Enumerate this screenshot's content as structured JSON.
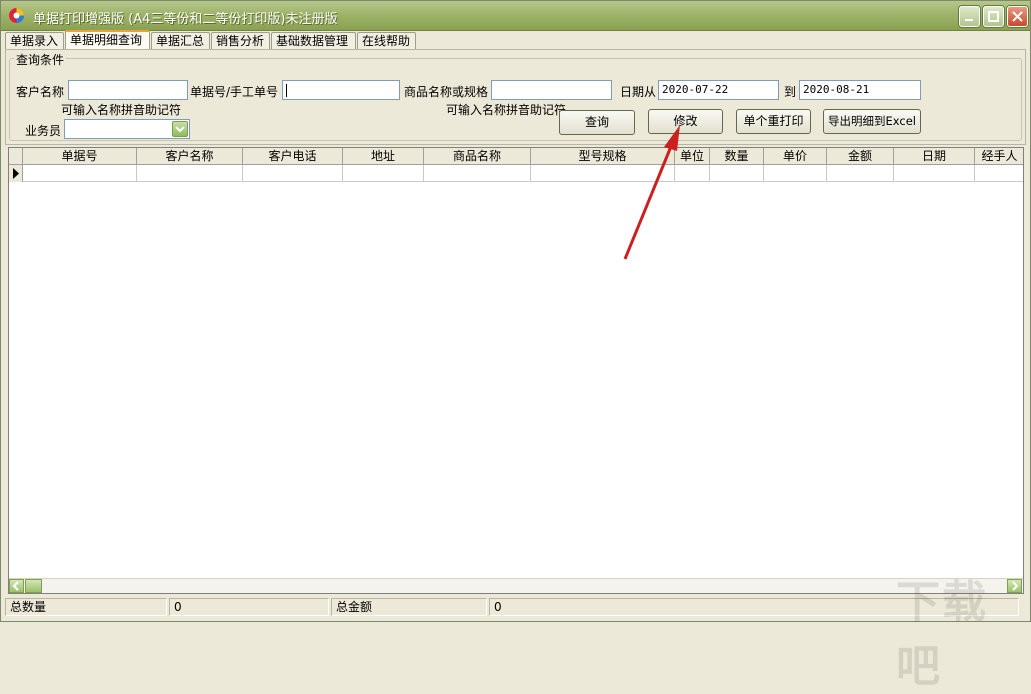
{
  "window": {
    "title": "单据打印增强版 (A4三等份和二等份打印版)未注册版"
  },
  "tabs": [
    {
      "label": "单据录入",
      "active": false
    },
    {
      "label": "单据明细查询",
      "active": true
    },
    {
      "label": "单据汇总",
      "active": false
    },
    {
      "label": "销售分析",
      "active": false
    },
    {
      "label": "基础数据管理",
      "active": false
    },
    {
      "label": "在线帮助",
      "active": false
    }
  ],
  "query": {
    "group_title": "查询条件",
    "customer_label": "客户名称",
    "customer_value": "",
    "customer_hint": "可输入名称拼音助记符",
    "doc_no_label": "单据号/手工单号",
    "doc_no_value": "",
    "product_label": "商品名称或规格",
    "product_value": "",
    "product_hint": "可输入名称拼音助记符",
    "date_from_label": "日期从",
    "date_from_value": "2020-07-22",
    "date_to_label": "到",
    "date_to_value": "2020-08-21",
    "salesperson_label": "业务员",
    "salesperson_value": "",
    "buttons": {
      "search": "查询",
      "modify": "修改",
      "reprint": "单个重打印",
      "export": "导出明细到Excel"
    }
  },
  "grid": {
    "columns": [
      "单据号",
      "客户名称",
      "客户电话",
      "地址",
      "商品名称",
      "型号规格",
      "单位",
      "数量",
      "单价",
      "金额",
      "日期",
      "经手人"
    ]
  },
  "status": {
    "total_qty_label": "总数量",
    "total_qty_value": "0",
    "total_amount_label": "总金额",
    "total_amount_value": "0"
  },
  "colors": {
    "titlebar": "#9fb46a",
    "arrow": "#cc2020",
    "active_tab_accent": "#e8a33a"
  },
  "watermark": "下载吧"
}
